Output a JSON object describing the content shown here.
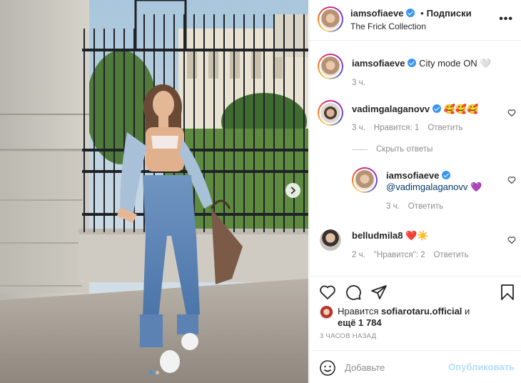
{
  "post": {
    "author": "iamsofiaeve",
    "follow_label": "Подписки",
    "separator": "•",
    "location": "The Frick Collection",
    "more_label": "•••"
  },
  "comments": [
    {
      "user": "iamsofiaeve",
      "verified": true,
      "text": "City mode ON",
      "emoji": "🤍",
      "time": "3 ч."
    },
    {
      "user": "vadimgalaganovv",
      "verified": true,
      "text": "",
      "emoji": "🥰🥰🥰",
      "time": "3 ч.",
      "likes": "Нравится: 1",
      "reply": "Ответить"
    },
    {
      "user": "iamsofiaeve",
      "verified": true,
      "mention": "@vadimgalaganovv",
      "emoji": "💜",
      "time": "3 ч.",
      "reply": "Ответить"
    },
    {
      "user": "belludmila8",
      "verified": false,
      "text": "",
      "emoji": "❤️☀️",
      "time": "2 ч.",
      "likes": "\"Нравится\": 2",
      "reply": "Ответить"
    }
  ],
  "hide_replies_label": "Скрыть ответы",
  "likes": {
    "prefix": "Нравится",
    "user": "sofiarotaru.official",
    "and_label": "и",
    "more": "ещё 1 784"
  },
  "time_ago": "3 ЧАСОВ НАЗАД",
  "add_comment": {
    "placeholder": "Добавьте",
    "post_label": "Опубликовать"
  },
  "colors": {
    "verified": "#3897f0",
    "link": "#00376b",
    "muted": "#8e8e8e",
    "post_disabled": "#b2dffc"
  },
  "carousel": {
    "count": 2,
    "active_index": 0
  },
  "icons": [
    "chevron-right-icon",
    "heart-icon",
    "comment-icon",
    "share-icon",
    "bookmark-icon",
    "smile-icon",
    "more-icon"
  ]
}
